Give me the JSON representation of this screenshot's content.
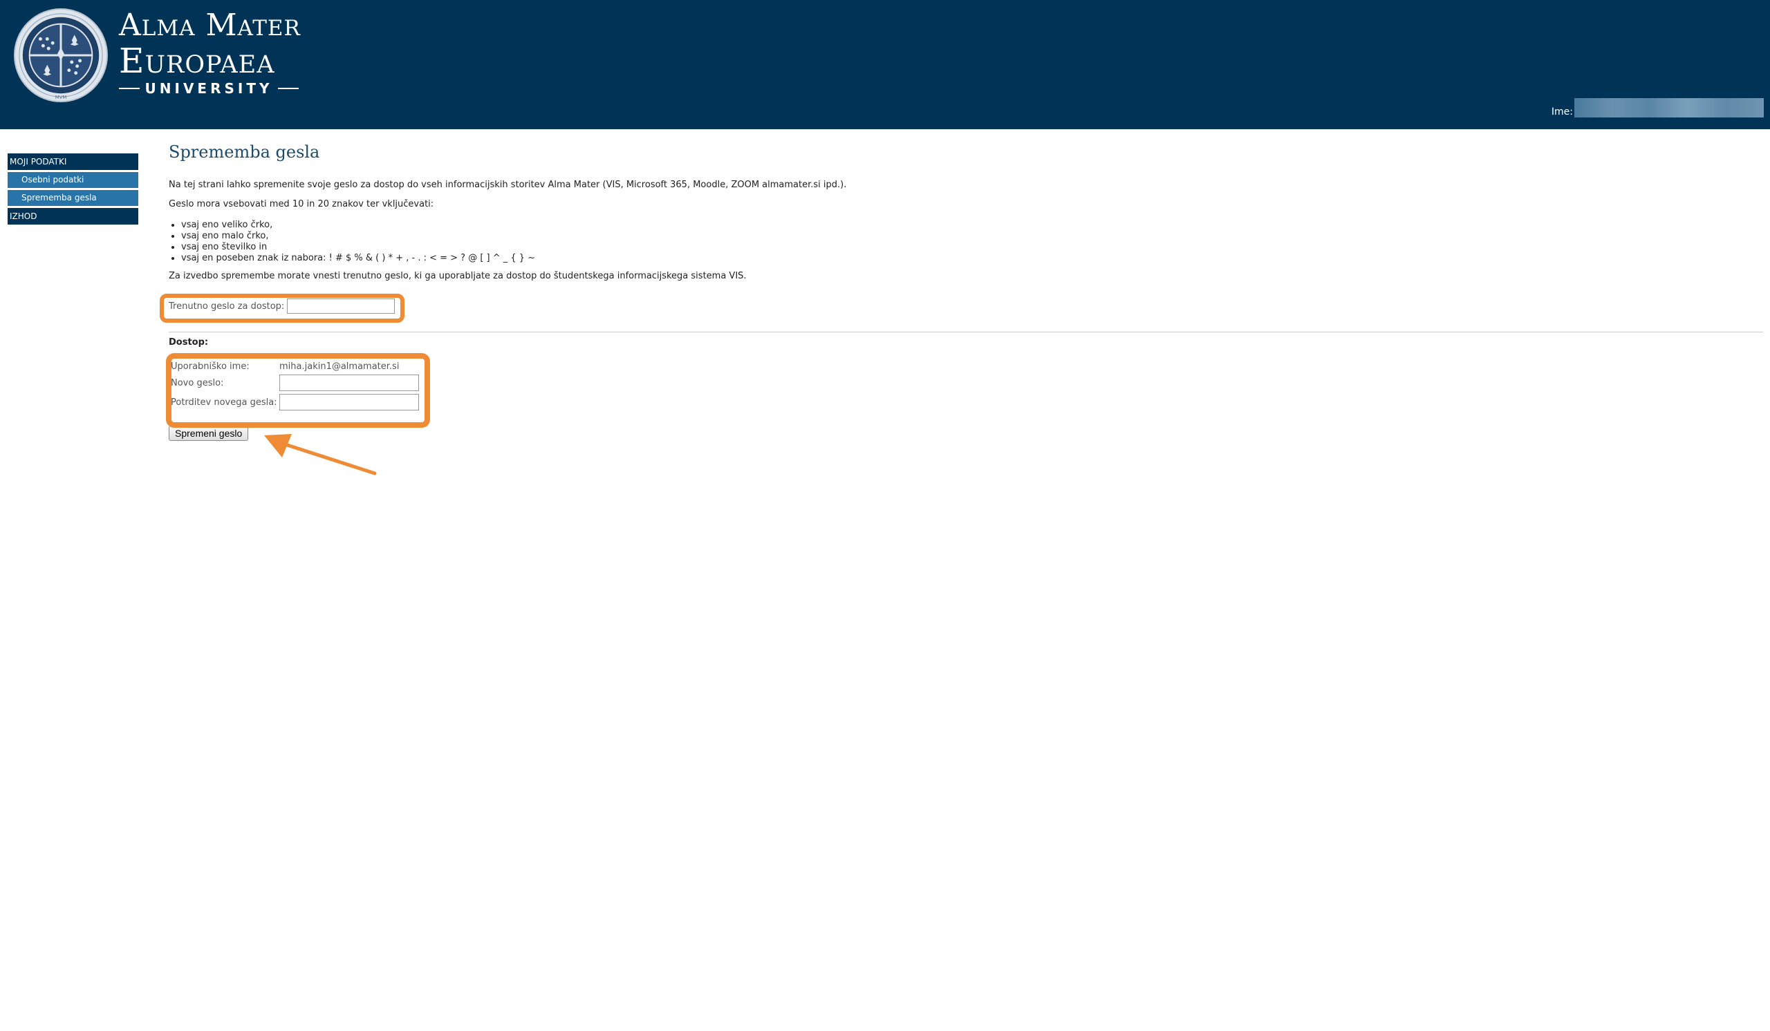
{
  "header": {
    "brand": {
      "line1": "Alma Mater",
      "line2": "Europaea",
      "line3": "UNIVERSITY",
      "seal_bottom": "MVM"
    },
    "user_label": "Ime:"
  },
  "sidebar": {
    "items": [
      {
        "label": "MOJI PODATKI",
        "level": "head"
      },
      {
        "label": "Osebni podatki",
        "level": "sub"
      },
      {
        "label": "Sprememba gesla",
        "level": "sub"
      },
      {
        "label": "IZHOD",
        "level": "head"
      }
    ]
  },
  "main": {
    "title": "Sprememba gesla",
    "intro": "Na tej strani lahko spremenite svoje geslo za dostop do vseh informacijskih storitev Alma Mater (VIS, Microsoft 365, Moodle, ZOOM almamater.si ipd.).",
    "requirement": "Geslo mora vsebovati med 10 in 20 znakov ter vključevati:",
    "rules": [
      "vsaj eno veliko črko,",
      "vsaj eno malo črko,",
      "vsaj eno številko in",
      "vsaj en poseben znak iz nabora: ! # $ % & ( ) * + , - . : < = > ? @ [ ] ^ _ { } ~"
    ],
    "current_note": "Za izvedbo spremembe morate vnesti trenutno geslo, ki ga uporabljate za dostop do študentskega informacijskega sistema VIS.",
    "current_label": "Trenutno geslo za dostop:",
    "current_value": "",
    "dostop_title": "Dostop:",
    "username_label": "Uporabniško ime:",
    "username_value": "miha.jakin1@almamater.si",
    "new_password_label": "Novo geslo:",
    "new_password_value": "",
    "confirm_label": "Potrditev novega gesla:",
    "confirm_value": "",
    "submit_label": "Spremeni geslo"
  },
  "colors": {
    "header_bg": "#003356",
    "nav_head_bg": "#003356",
    "nav_sub_bg": "#2874a8",
    "title_color": "#1d4a6a",
    "highlight": "#ee8b34"
  }
}
